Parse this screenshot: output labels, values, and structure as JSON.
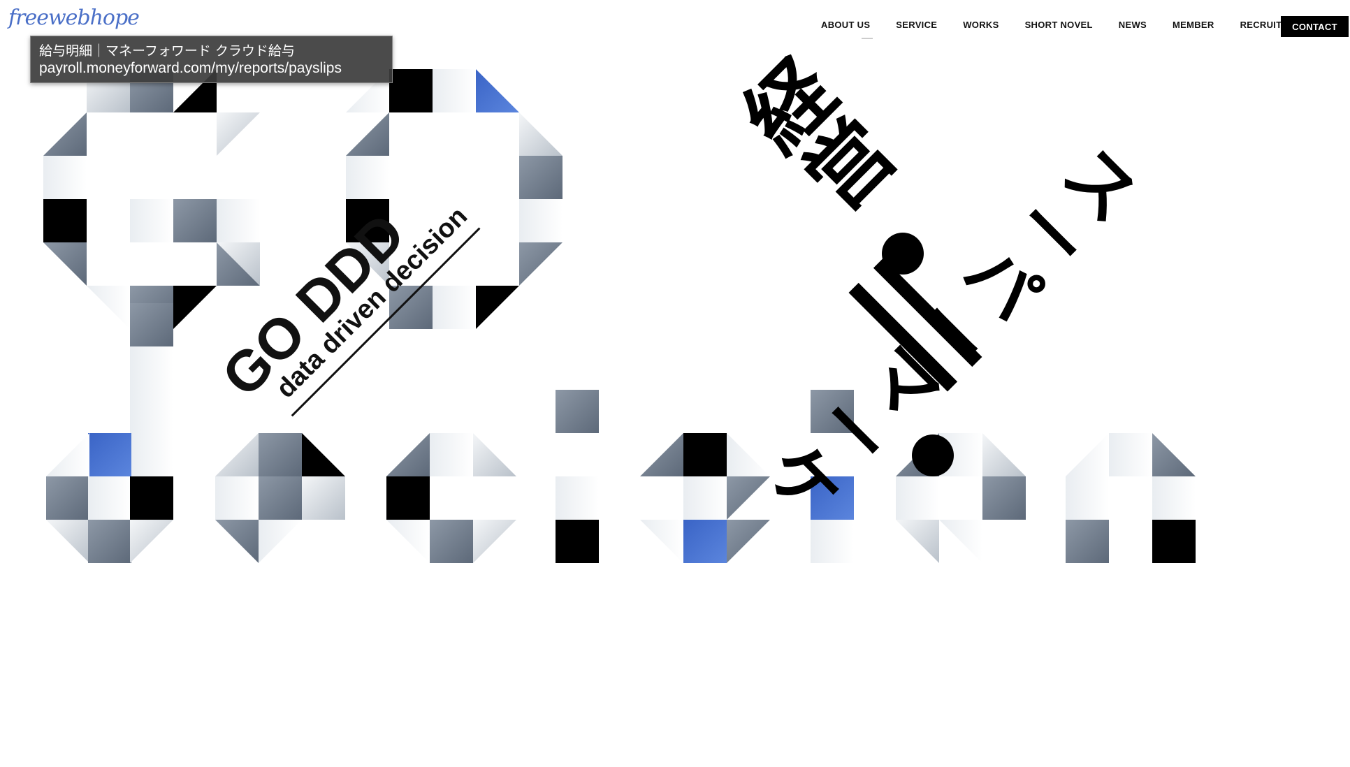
{
  "header": {
    "logo_text": "freewebhope",
    "nav": [
      "ABOUT US",
      "SERVICE",
      "WORKS",
      "SHORT NOVEL",
      "NEWS",
      "MEMBER",
      "RECRUIT"
    ],
    "contact_label": "CONTACT"
  },
  "tooltip": {
    "title": "給与明細｜マネーフォワード クラウド給与",
    "url": "payroll.moneyforward.com/my/reports/payslips"
  },
  "hero": {
    "headline": "GO DDD",
    "tagline": "data driven decision",
    "vertical_lines": [
      "経営",
      "＝",
      "スーパーマーケティング"
    ],
    "big_words": [
      "GO",
      "decision"
    ]
  },
  "colors": {
    "black": "#000000",
    "accent_blue": "#4a72cf",
    "slate": "#6f7c8d",
    "silver": "#c7cdd4"
  }
}
